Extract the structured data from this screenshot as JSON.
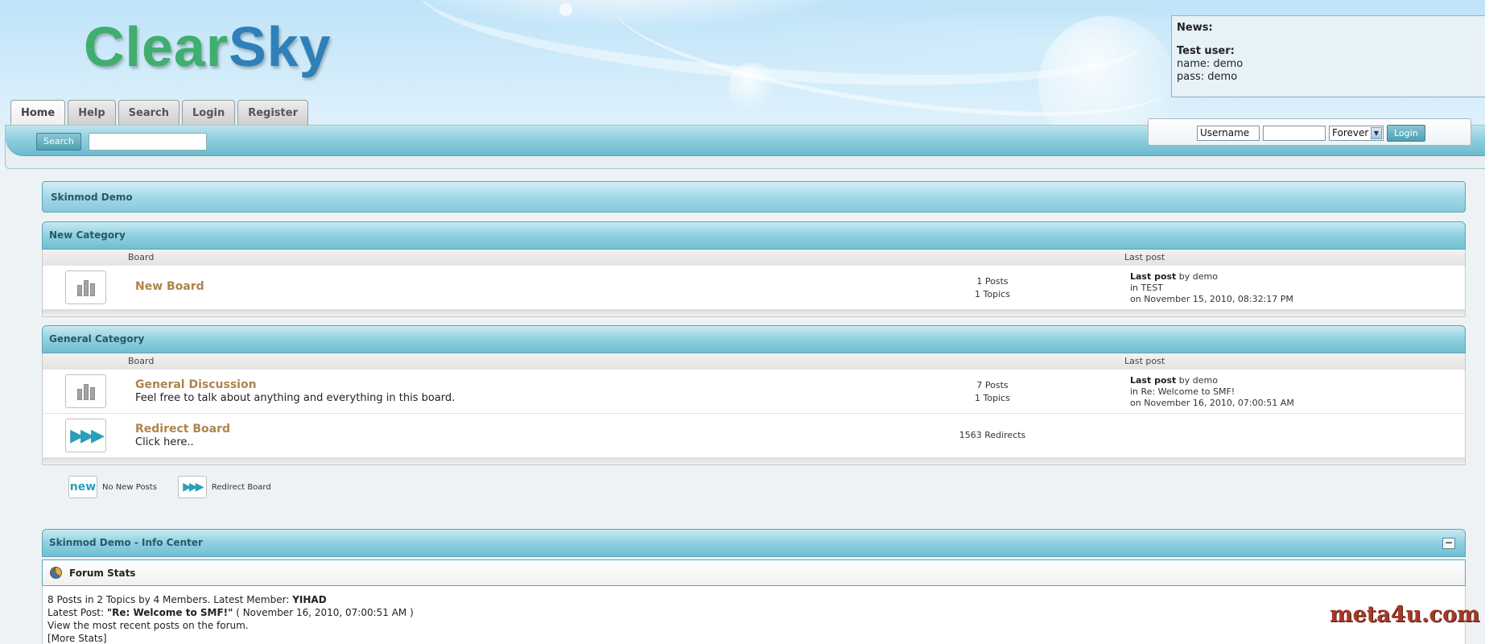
{
  "logo": {
    "part1": "Clear",
    "part2": "Sky"
  },
  "tabs": [
    {
      "label": "Home"
    },
    {
      "label": "Help"
    },
    {
      "label": "Search"
    },
    {
      "label": "Login"
    },
    {
      "label": "Register"
    }
  ],
  "search": {
    "button_label": "Search",
    "value": ""
  },
  "news": {
    "title": "News:",
    "test_user_label": "Test user:",
    "name_line": "name: demo",
    "pass_line": "pass:  demo"
  },
  "login": {
    "username_value": "Username",
    "password_value": "",
    "duration": "Forever",
    "button_label": "Login"
  },
  "forum_title": "Skinmod Demo",
  "categories": [
    {
      "name": "New Category",
      "col_board": "Board",
      "col_last": "Last post",
      "boards": [
        {
          "name": "New Board",
          "description": "",
          "stat1": "1 Posts",
          "stat2": "1 Topics",
          "last_label": "Last post",
          "last_by": " by demo",
          "last_in": "in TEST",
          "last_on": "on November 15, 2010, 08:32:17 PM"
        }
      ]
    },
    {
      "name": "General Category",
      "col_board": "Board",
      "col_last": "Last post",
      "boards": [
        {
          "name": "General Discussion",
          "description": "Feel free to talk about anything and everything in this board.",
          "stat1": "7 Posts",
          "stat2": "1 Topics",
          "last_label": "Last post",
          "last_by": " by demo",
          "last_in": "in Re: Welcome to SMF!",
          "last_on": "on November 16, 2010, 07:00:51 AM"
        },
        {
          "name": "Redirect Board",
          "description": "Click here..",
          "stat1": "1563 Redirects"
        }
      ]
    }
  ],
  "legend": {
    "no_new_posts": "No New Posts",
    "redirect_board": "Redirect Board",
    "new_icon_text": "new"
  },
  "info_center": {
    "title": "Skinmod Demo - Info Center",
    "collapse_symbol": "−",
    "stats_title": "Forum Stats",
    "line1_prefix": "8 Posts in 2 Topics by 4 Members. Latest Member: ",
    "line1_member": "YIHAD",
    "line2_prefix": "Latest Post: ",
    "line2_post": "\"Re: Welcome to SMF!\"",
    "line2_suffix": " ( November 16, 2010, 07:00:51 AM )",
    "line3": "View the most recent posts on the forum.",
    "line4": "[More Stats]"
  },
  "watermark": "meta4u.com"
}
